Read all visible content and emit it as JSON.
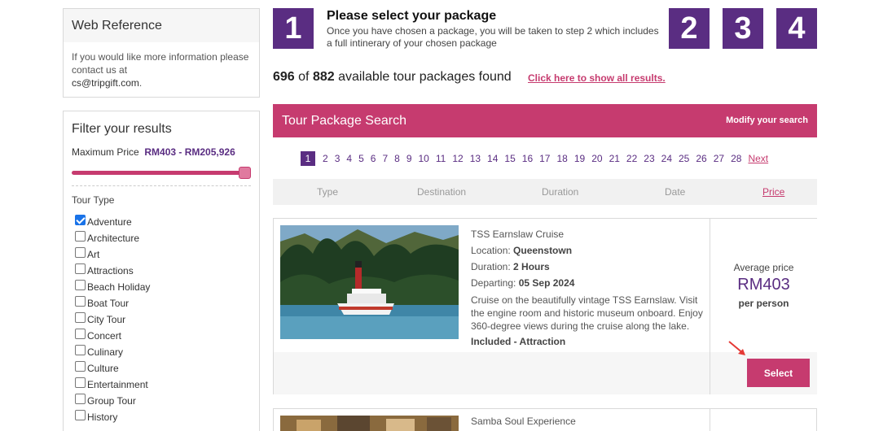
{
  "web_reference": {
    "title": "Web Reference",
    "text": "If you would like more information please contact us at",
    "email": "cs@tripgift.com",
    "email_suffix": "."
  },
  "filter": {
    "title": "Filter your results",
    "max_price_label": "Maximum Price",
    "price_min": "RM403",
    "price_sep": " - ",
    "price_max": "RM205,926",
    "slider_fraction": 1.0,
    "tour_type_label": "Tour Type",
    "tour_types": [
      {
        "label": "Adventure",
        "checked": true
      },
      {
        "label": "Architecture",
        "checked": false
      },
      {
        "label": "Art",
        "checked": false
      },
      {
        "label": "Attractions",
        "checked": false
      },
      {
        "label": "Beach Holiday",
        "checked": false
      },
      {
        "label": "Boat Tour",
        "checked": false
      },
      {
        "label": "City Tour",
        "checked": false
      },
      {
        "label": "Concert",
        "checked": false
      },
      {
        "label": "Culinary",
        "checked": false
      },
      {
        "label": "Culture",
        "checked": false
      },
      {
        "label": "Entertainment",
        "checked": false
      },
      {
        "label": "Group Tour",
        "checked": false
      },
      {
        "label": "History",
        "checked": false
      }
    ]
  },
  "steps": {
    "current": "1",
    "title": "Please select your package",
    "description": "Once you have chosen a package, you will be taken to step 2 which includes a full intinerary of your chosen package",
    "others": [
      "2",
      "3",
      "4"
    ]
  },
  "results": {
    "count": "696",
    "of": "of",
    "total": "882",
    "suffix": "available tour packages found",
    "show_all": "Click here to show all results."
  },
  "search_bar": {
    "title": "Tour Package Search",
    "modify": "Modify your search"
  },
  "pagination": {
    "current": "1",
    "pages": [
      "2",
      "3",
      "4",
      "5",
      "6",
      "7",
      "8",
      "9",
      "10",
      "11",
      "12",
      "13",
      "14",
      "15",
      "16",
      "17",
      "18",
      "19",
      "20",
      "21",
      "22",
      "23",
      "24",
      "25",
      "26",
      "27",
      "28"
    ],
    "next": "Next"
  },
  "sort": {
    "type": "Type",
    "destination": "Destination",
    "duration": "Duration",
    "date": "Date",
    "price": "Price"
  },
  "packages": [
    {
      "name": "TSS Earnslaw Cruise",
      "location_label": "Location:",
      "location": "Queenstown",
      "duration_label": "Duration:",
      "duration": "2 Hours",
      "departing_label": "Departing:",
      "departing": "05 Sep 2024",
      "description": "Cruise on the beautifully vintage TSS Earnslaw. Visit the engine room and historic museum onboard. Enjoy 360-degree views during the cruise along the lake.",
      "included": "Included - Attraction",
      "avg_label": "Average price",
      "price": "RM403",
      "per": "per person",
      "select": "Select"
    },
    {
      "name": "Samba Soul Experience"
    }
  ],
  "colors": {
    "brand_purple": "#5a2d82",
    "brand_pink": "#c63b6f"
  }
}
